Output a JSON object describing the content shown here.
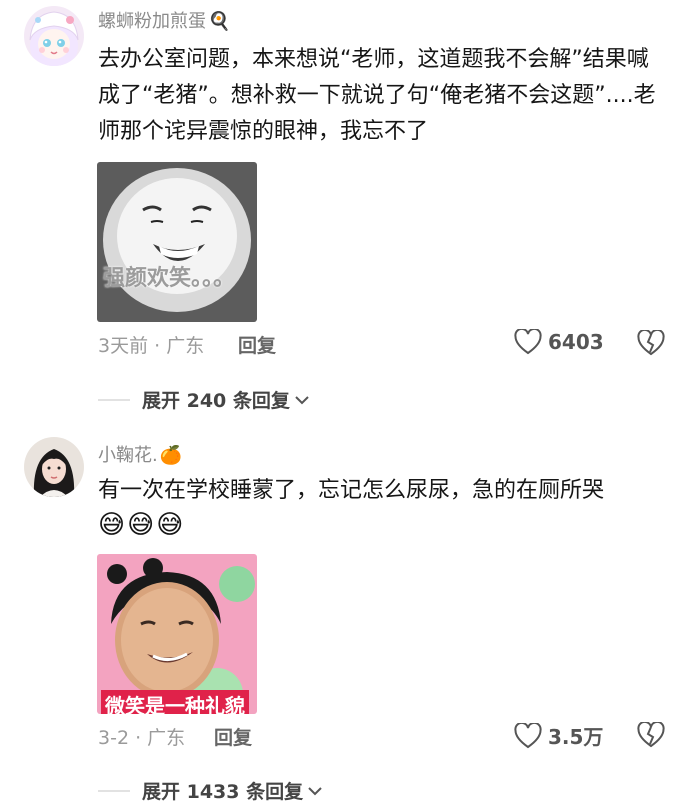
{
  "comments": [
    {
      "username": "螺蛳粉加煎蛋",
      "badge": "🍳",
      "content": "去办公室问题，本来想说“老师，这道题我不会解”结果喊成了“老猪”。想补救一下就说了句“俺老猪不会这题”....老师那个诧异震惊的眼神，我忘不了",
      "sticker_caption": "强颜欢笑。。。",
      "meta": "3天前 · 广东",
      "reply_label": "回复",
      "likes": "6403",
      "expand_label": "展开 240 条回复"
    },
    {
      "username": "小鞠花.",
      "badge": "🍊",
      "content": "有一次在学校睡蒙了，忘记怎么尿尿，急的在厕所哭",
      "emojis": "😅😅😅",
      "sticker_caption": "微笑是一种礼貌",
      "meta": "3-2 · 广东",
      "reply_label": "回复",
      "likes": "3.5万",
      "expand_label": "展开 1433 条回复"
    }
  ]
}
